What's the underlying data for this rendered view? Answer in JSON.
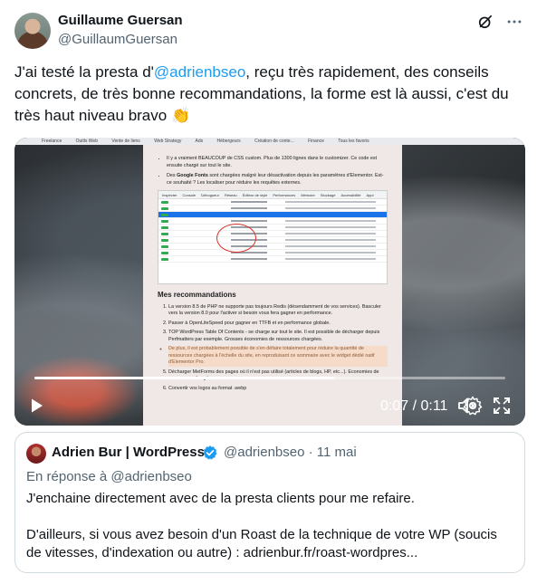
{
  "tweet": {
    "author_name": "Guillaume Guersan",
    "author_handle": "@GuillaumGuersan",
    "text_prefix": "J'ai testé la presta d'",
    "mention": "@adrienbseo",
    "text_suffix": ", reçu très rapidement, des conseils concrets, de très bonne recommandations, la forme est là aussi, c'est du très haut niveau bravo 👏"
  },
  "icons": {
    "grok": "grok-icon",
    "more": "more-icon",
    "play": "play-icon",
    "volume": "volume-icon",
    "settings": "settings-icon",
    "fullscreen": "fullscreen-icon",
    "verified": "verified-icon"
  },
  "video": {
    "time_display": "0:07 / 0:11",
    "progress": 0.636,
    "browser_bookmarks": [
      "Freelance",
      "Outils Web",
      "Vente de liens",
      "Web Strategy",
      "Ads",
      "Hébergeurs",
      "Création de conte...",
      "Finance",
      "Tous les favoris"
    ],
    "doc": {
      "bullet_1": "Il y a vraiment BEAUCOUP de CSS custom. Plus de 1300 lignes dans le customizer. Ce code est ensuite chargé sur tout le site.",
      "bullet_2_prefix": "Des ",
      "bullet_2_bold": "Google Fonts",
      "bullet_2_suffix": " sont chargées malgré leur désactivation depuis les paramètres d'Elementor. Est-ce souhaité ? Les localiser pour réduire les requêtes externes.",
      "devtools_tabs": [
        "Inspecter",
        "Console",
        "Débogueur",
        "Réseau",
        "Éditeur de style",
        "Performances",
        "Mémoire",
        "Stockage",
        "Accessibilité",
        "Appl"
      ],
      "section_title": "Mes recommandations",
      "rec_1": "La version 8.5 de PHP ne supporte pas toujours Redis (désendamment de vos services). Basculer vers la version 8.0 pour l'activer si besoin vous fera gagner en performance.",
      "rec_2": "Passer à OpenLiteSpeed pour gagner en TTFB et en performance globale.",
      "rec_3": "TOP WordPress Table Of Contents - se charge sur tout le site. Il est possible de décharger depuis Perfmatters par exemple. Grosses économies de ressources chargées.",
      "rec_3_note": "De plus, il est probablement possible de s'en défaire totalement pour réduire la quantité de ressources chargées à l'échelle du site, en reproduisant ce sommaire avec le widget dédié natif d'Elementor Pro.",
      "rec_4": "Décharger MetForms des pages où il n'est pas utilisé (articles de blogs, HP, etc...). Economies de ressources chargées.",
      "rec_5": "Convertir vos logos au format .webp"
    }
  },
  "quote": {
    "author_name": "Adrien Bur | WordPress",
    "author_handle": "@adrienbseo · 11 mai",
    "reply_to": "En réponse à @adrienbseo",
    "line_1": "J'enchaine directement avec de la presta clients pour me refaire.",
    "line_2": "D'ailleurs, si vous avez besoin d'un Roast de la technique de votre WP (soucis de vitesses, d'indexation ou autre) : adrienbur.fr/roast-wordpres..."
  },
  "colors": {
    "link": "#1d9bf0",
    "secondary_text": "#536471",
    "border": "#cfd9de",
    "verified": "#1d9bf0"
  }
}
